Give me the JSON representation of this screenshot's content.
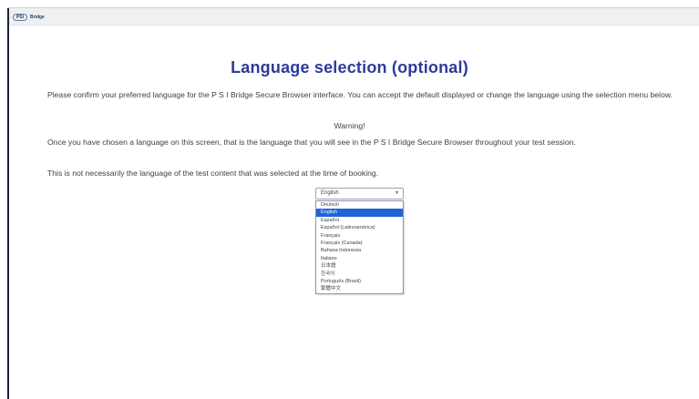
{
  "topbar": {
    "logo_badge": "PSI",
    "logo_word": "Bridge"
  },
  "page": {
    "title": "Language selection (optional)",
    "intro": "Please confirm your preferred language for the P S I Bridge Secure Browser interface. You can accept the default displayed or change the language using the selection menu below.",
    "warning_heading": "Warning!",
    "warning_text": "Once you have chosen a language on this screen, that is the language that you will see in the P S I Bridge Secure Browser throughout your test session.",
    "note": "This is not necessarily the language of the test content that was selected at the time of booking."
  },
  "language_select": {
    "selected_value": "English",
    "options": [
      "Deutsch",
      "English",
      "Español",
      "Español (Latinoamérica)",
      "Français",
      "Français (Canada)",
      "Bahasa Indonesia",
      "Italiano",
      "日本語",
      "한국어",
      "Português (Brasil)",
      "繁體中文"
    ],
    "highlighted_index": 1
  },
  "colors": {
    "title": "#2c3b9a",
    "highlight": "#1e63d6",
    "topbar": "#eef0f2"
  }
}
